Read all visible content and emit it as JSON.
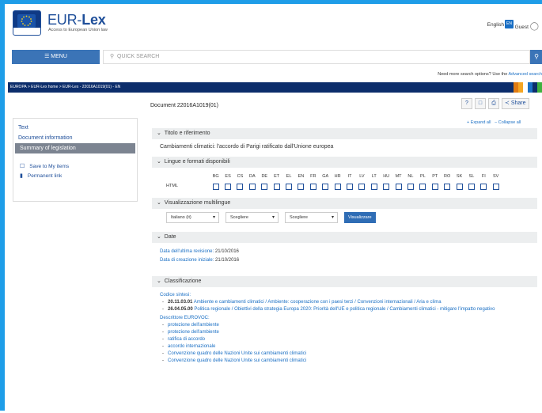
{
  "header": {
    "brand_prefix": "EUR-",
    "brand_suffix": "Lex",
    "tagline": "Access to European Union law",
    "language": "English",
    "language_code": "EN",
    "guest": "Guest"
  },
  "menu": {
    "label": "☰  MENU"
  },
  "search": {
    "placeholder": "QUICK SEARCH"
  },
  "advanced": {
    "prefix": "Need more search options? Use the ",
    "link": "Advanced search"
  },
  "breadcrumb": {
    "text": "EUROPA  >  EUR-Lex home  >  EUR-Lex - 22016A1019(01) - EN"
  },
  "document": {
    "title": "Document 22016A1019(01)",
    "share": "Share"
  },
  "expand": {
    "expand_all": "+ Expand all",
    "collapse_all": "− Collapse all"
  },
  "sidebar": {
    "items": [
      {
        "label": "Text"
      },
      {
        "label": "Document information"
      },
      {
        "label": "Summary of legislation"
      }
    ],
    "links": [
      {
        "label": "Save to My items"
      },
      {
        "label": "Permanent link"
      }
    ]
  },
  "sections": {
    "titolo": {
      "heading": "Titolo e riferimento",
      "text": "Cambiamenti climatici: l'accordo di Parigi ratificato dall'Unione europea"
    },
    "lingue": {
      "heading": "Lingue e formati disponibili",
      "codes": [
        "BG",
        "ES",
        "CS",
        "DA",
        "DE",
        "ET",
        "EL",
        "EN",
        "FR",
        "GA",
        "HR",
        "IT",
        "LV",
        "LT",
        "HU",
        "MT",
        "NL",
        "PL",
        "PT",
        "RO",
        "SK",
        "SL",
        "FI",
        "SV"
      ],
      "format": "HTML"
    },
    "visual": {
      "heading": "Visualizzazione multilingue",
      "sel1": "Italiano (it)",
      "sel2": "Scegliere",
      "sel3": "Scegliere",
      "button": "Visualizzare"
    },
    "date": {
      "heading": "Date",
      "rev_label": "Data dell'ultima revisione:",
      "rev_value": "21/10/2016",
      "cre_label": "Data di creazione iniziale:",
      "cre_value": "21/10/2016"
    },
    "class": {
      "heading": "Classificazione",
      "codice_label": "Codice sintesi:",
      "c1_code": "20.11.03.01",
      "c1_text": "Ambiente e cambiamenti climatici / Ambiente: cooperazione con i paesi terzi / Convenzioni internazionali / Aria e clima",
      "c2_code": "26.04.05.00",
      "c2_text": "Politica regionale / Obiettivi della strategia Europa 2020: Priorità dell'UE e politica regionale / Cambiamenti climatici - mitigare l'impatto negativo",
      "eurovoc_label": "Descrittore EUROVOC:",
      "eurovoc": [
        "protezione dell'ambiente",
        "protezione dell'ambiente",
        "ratifica di accordo",
        "accordo internazionale",
        "Convenzione quadro delle Nazioni Unite sui cambiamenti climatici",
        "Convenzione quadro delle Nazioni Unite sui cambiamenti climatici"
      ]
    }
  }
}
